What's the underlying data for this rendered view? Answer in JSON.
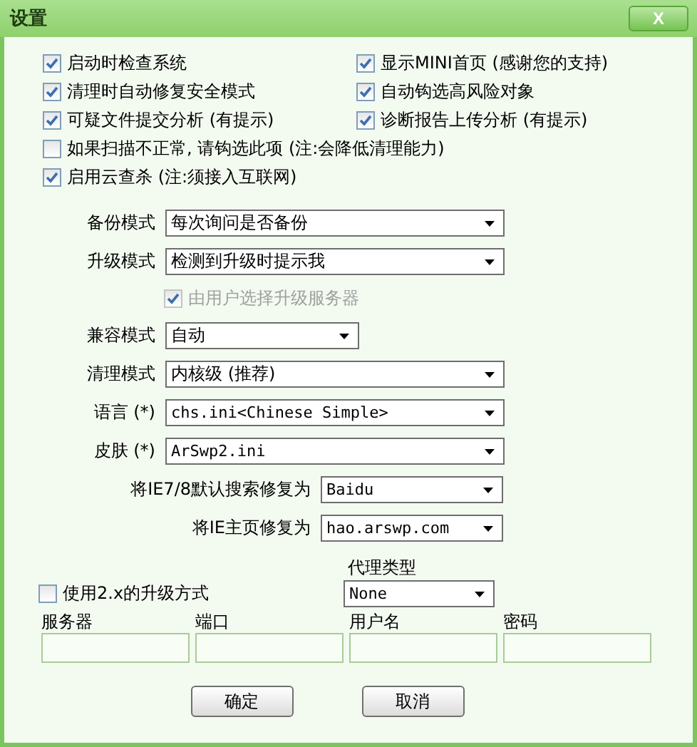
{
  "window": {
    "title": "设置",
    "close": "X"
  },
  "options": [
    {
      "label": "启动时检查系统",
      "checked": true
    },
    {
      "label": "显示MINI首页 (感谢您的支持)",
      "checked": true
    },
    {
      "label": "清理时自动修复安全模式",
      "checked": true
    },
    {
      "label": "自动钩选高风险对象",
      "checked": true
    },
    {
      "label": "可疑文件提交分析 (有提示)",
      "checked": true
    },
    {
      "label": "诊断报告上传分析 (有提示)",
      "checked": true
    },
    {
      "label": "如果扫描不正常, 请钩选此项 (注:会降低清理能力)",
      "checked": false
    },
    {
      "label": "启用云查杀 (注:须接入互联网)",
      "checked": true
    }
  ],
  "settings": [
    {
      "kind": "select",
      "label": "备份模式",
      "value": "每次询问是否备份"
    },
    {
      "kind": "select",
      "label": "升级模式",
      "value": "检测到升级时提示我"
    },
    {
      "kind": "check",
      "label": "由用户选择升级服务器",
      "checked": true,
      "disabled": true
    },
    {
      "kind": "select",
      "label": "兼容模式",
      "value": "自动"
    },
    {
      "kind": "select",
      "label": "清理模式",
      "value": "内核级 (推荐)"
    },
    {
      "kind": "select",
      "label": "语言 (*)",
      "value": "chs.ini<Chinese Simple>"
    },
    {
      "kind": "select",
      "label": "皮肤 (*)",
      "value": "ArSwp2.ini"
    },
    {
      "kind": "select",
      "label": "将IE7/8默认搜索修复为",
      "value": "Baidu"
    },
    {
      "kind": "select",
      "label": "将IE主页修复为",
      "value": "hao.arswp.com"
    }
  ],
  "proxy": {
    "type_label": "代理类型",
    "legacy": {
      "label": "使用2.x的升级方式",
      "checked": false
    },
    "type_value": "None",
    "fields": [
      {
        "label": "服务器"
      },
      {
        "label": "端口"
      },
      {
        "label": "用户名"
      },
      {
        "label": "密码"
      }
    ]
  },
  "buttons": [
    "确定",
    "取消"
  ]
}
